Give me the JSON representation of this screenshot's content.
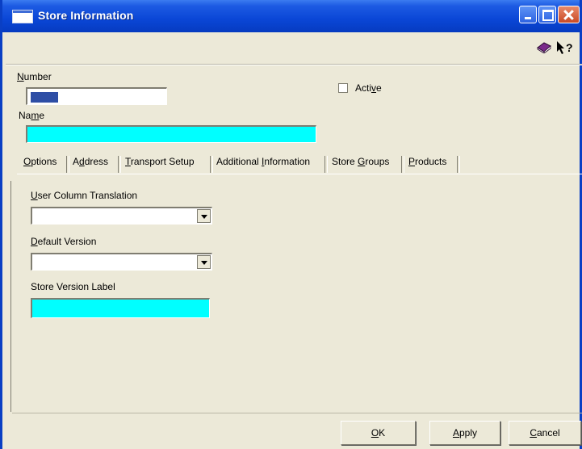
{
  "window": {
    "title": "Store Information"
  },
  "form": {
    "number_label": "Number",
    "number_value": "",
    "active_label": "Active",
    "active_checked": false,
    "name_label": "Name",
    "name_value": ""
  },
  "tabs": [
    {
      "label": "Options",
      "selected": true
    },
    {
      "label": "Address",
      "selected": false
    },
    {
      "label": "Transport Setup",
      "selected": false
    },
    {
      "label": "Additional Information",
      "selected": false
    },
    {
      "label": "Store Groups",
      "selected": false
    },
    {
      "label": "Products",
      "selected": false
    }
  ],
  "options": {
    "user_column_translation_label": "User Column Translation",
    "user_column_translation_value": "",
    "default_version_label": "Default Version",
    "default_version_value": "",
    "store_version_label_label": "Store Version Label",
    "store_version_label_value": ""
  },
  "buttons": {
    "ok": "OK",
    "apply": "Apply",
    "cancel": "Cancel"
  },
  "colors": {
    "titlebar": "#0a46d6",
    "highlight_field": "#00ffff",
    "dialog_bg": "#ece9d8",
    "selection": "#2e4ea5"
  },
  "icons": [
    "window-icon",
    "minimize-icon",
    "maximize-icon",
    "close-icon",
    "book-icon",
    "help-pointer-icon",
    "dropdown-arrow-icon"
  ]
}
